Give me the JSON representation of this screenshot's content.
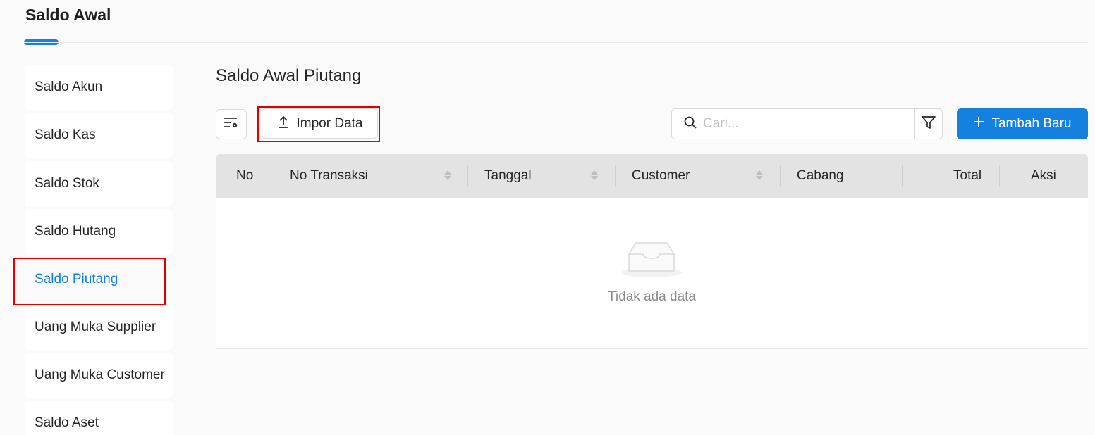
{
  "header": {
    "title": "Saldo Awal"
  },
  "sidebar": {
    "items": [
      {
        "label": "Saldo Akun"
      },
      {
        "label": "Saldo Kas"
      },
      {
        "label": "Saldo Stok"
      },
      {
        "label": "Saldo Hutang"
      },
      {
        "label": "Saldo Piutang",
        "active": true
      },
      {
        "label": "Uang Muka Supplier"
      },
      {
        "label": "Uang Muka Customer"
      },
      {
        "label": "Saldo Aset"
      }
    ]
  },
  "main": {
    "title": "Saldo Awal Piutang",
    "toolbar": {
      "settings_icon": "table-settings-icon",
      "import_label": "Impor Data",
      "import_icon": "upload-icon",
      "search_placeholder": "Cari...",
      "search_value": "",
      "search_icon": "search-icon",
      "filter_icon": "filter-icon",
      "add_label": "Tambah Baru",
      "add_icon": "plus-icon"
    },
    "table": {
      "columns": [
        "No",
        "No Transaksi",
        "Tanggal",
        "Customer",
        "Cabang",
        "Total",
        "Aksi"
      ],
      "rows": [],
      "empty_text": "Tidak ada data",
      "empty_icon": "empty-inbox-icon"
    }
  },
  "colors": {
    "accent": "#1480df",
    "highlight_border": "#e00000",
    "header_bg": "#e3e3e3"
  }
}
